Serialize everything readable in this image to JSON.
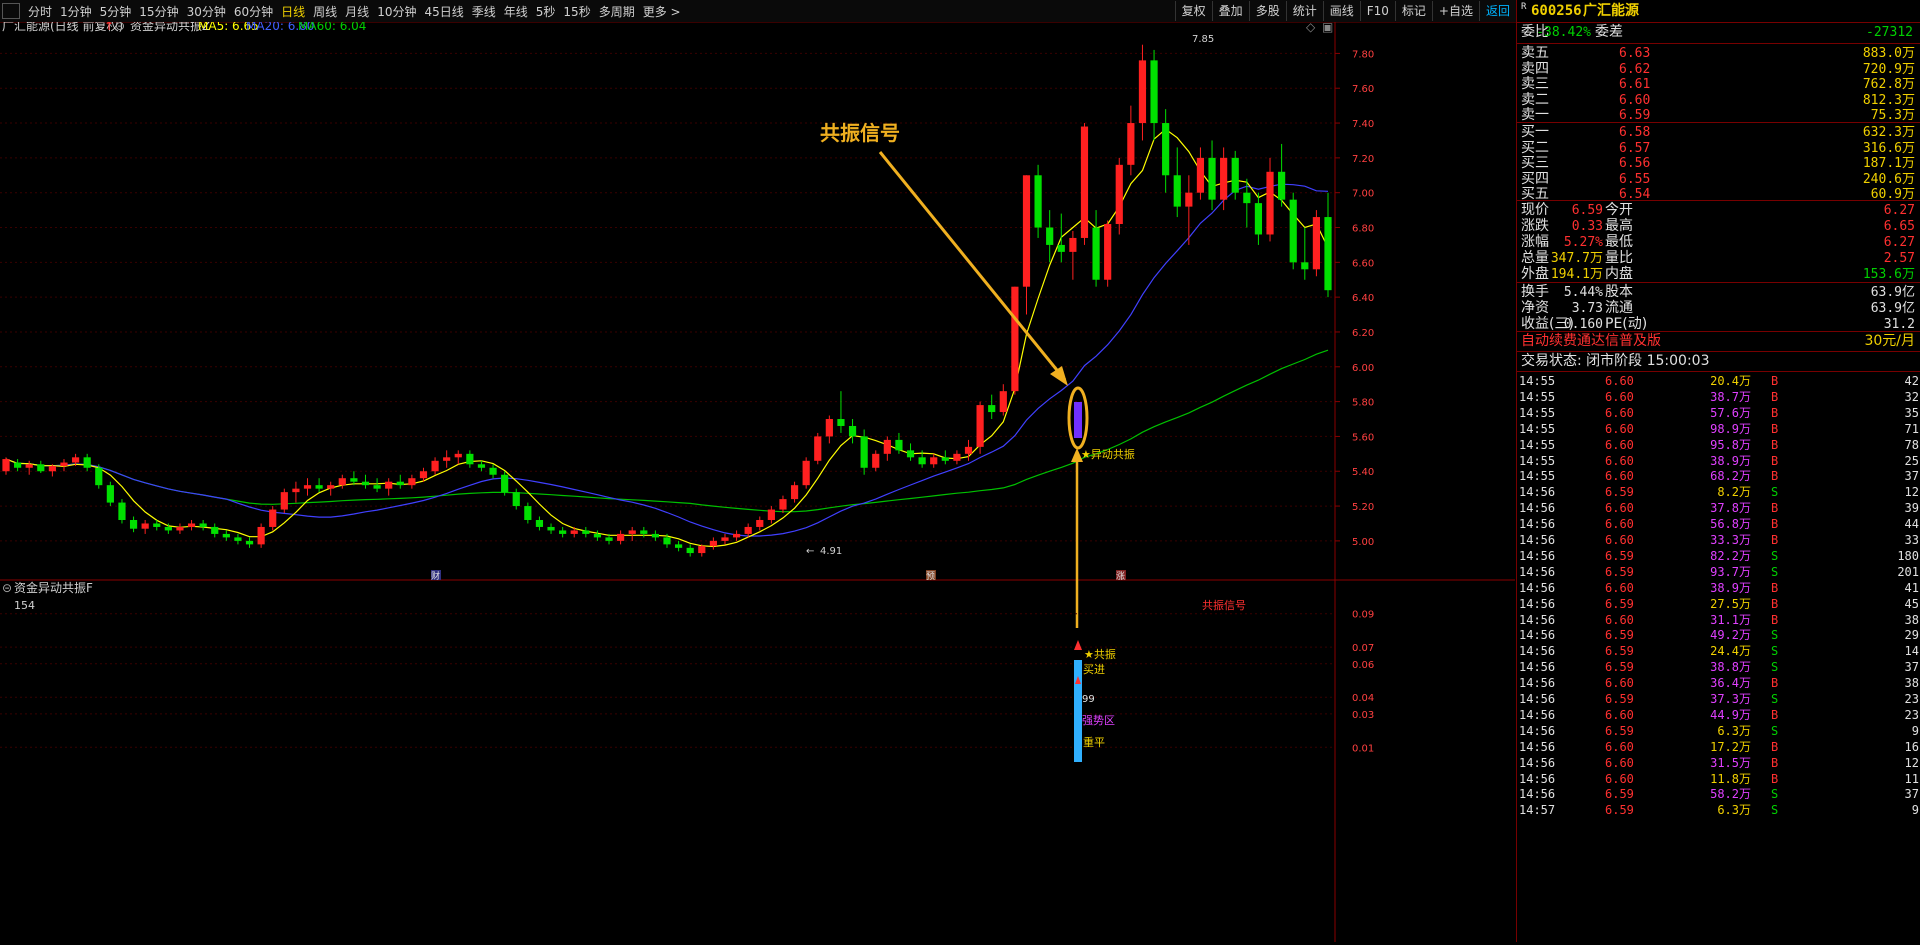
{
  "toolbar": {
    "timeframes": [
      "分时",
      "1分钟",
      "5分钟",
      "15分钟",
      "30分钟",
      "60分钟",
      "日线",
      "周线",
      "月线",
      "10分钟",
      "45日线",
      "季线",
      "年线",
      "5秒",
      "15秒",
      "多周期",
      "更多 >"
    ],
    "active": "日线",
    "tools": [
      "复权",
      "叠加",
      "多股",
      "统计",
      "画线",
      "F10",
      "标记",
      "+自选",
      "返回"
    ]
  },
  "main_header": {
    "stock": "广汇能源(日线 前复权)",
    "indicator": "资金异动共振Z",
    "ma5": "MA5: 6.65",
    "ma20": "MA20: 6.80",
    "ma60": "MA60: 6.04"
  },
  "sub_header": {
    "name": "资金异动共振F",
    "value": "154",
    "signal_label": "共振信号"
  },
  "annotations": {
    "callout": "共振信号",
    "star_label": "★异动共振",
    "high_label": "7.85",
    "low_label": "4.91",
    "markers": [
      "财",
      "预",
      "涨"
    ],
    "sub_labels": [
      "★共振",
      "买进",
      "99",
      "强势区",
      "重平"
    ]
  },
  "axes": {
    "main_y_ticks": [
      "7.80",
      "7.60",
      "7.40",
      "7.20",
      "7.00",
      "6.80",
      "6.60",
      "6.40",
      "6.20",
      "6.00",
      "5.80",
      "5.60",
      "5.40",
      "5.20",
      "5.00"
    ],
    "sub_y_ticks": [
      "0.09",
      "0.07",
      "0.06",
      "0.04",
      "0.03",
      "0.01"
    ]
  },
  "chart_data": {
    "type": "candlestick",
    "ohlc_note": "approximate daily candles read from chart",
    "candles": [
      [
        5.4,
        5.48,
        5.38,
        5.47
      ],
      [
        5.45,
        5.47,
        5.4,
        5.42
      ],
      [
        5.42,
        5.46,
        5.38,
        5.44
      ],
      [
        5.44,
        5.46,
        5.39,
        5.4
      ],
      [
        5.4,
        5.44,
        5.37,
        5.43
      ],
      [
        5.43,
        5.47,
        5.4,
        5.45
      ],
      [
        5.45,
        5.5,
        5.43,
        5.48
      ],
      [
        5.48,
        5.5,
        5.4,
        5.42
      ],
      [
        5.42,
        5.44,
        5.3,
        5.32
      ],
      [
        5.32,
        5.34,
        5.2,
        5.22
      ],
      [
        5.22,
        5.24,
        5.1,
        5.12
      ],
      [
        5.12,
        5.14,
        5.05,
        5.07
      ],
      [
        5.07,
        5.12,
        5.04,
        5.1
      ],
      [
        5.1,
        5.12,
        5.06,
        5.08
      ],
      [
        5.08,
        5.1,
        5.04,
        5.06
      ],
      [
        5.06,
        5.1,
        5.04,
        5.08
      ],
      [
        5.08,
        5.12,
        5.06,
        5.1
      ],
      [
        5.1,
        5.12,
        5.06,
        5.08
      ],
      [
        5.08,
        5.1,
        5.02,
        5.04
      ],
      [
        5.04,
        5.06,
        5.0,
        5.02
      ],
      [
        5.02,
        5.04,
        4.98,
        5.0
      ],
      [
        5.0,
        5.02,
        4.96,
        4.98
      ],
      [
        4.98,
        5.1,
        4.96,
        5.08
      ],
      [
        5.08,
        5.2,
        5.06,
        5.18
      ],
      [
        5.18,
        5.3,
        5.16,
        5.28
      ],
      [
        5.28,
        5.34,
        5.22,
        5.3
      ],
      [
        5.3,
        5.36,
        5.26,
        5.32
      ],
      [
        5.32,
        5.36,
        5.28,
        5.3
      ],
      [
        5.3,
        5.34,
        5.26,
        5.32
      ],
      [
        5.32,
        5.38,
        5.3,
        5.36
      ],
      [
        5.36,
        5.4,
        5.32,
        5.34
      ],
      [
        5.34,
        5.38,
        5.3,
        5.32
      ],
      [
        5.32,
        5.36,
        5.28,
        5.3
      ],
      [
        5.3,
        5.36,
        5.26,
        5.34
      ],
      [
        5.34,
        5.38,
        5.3,
        5.32
      ],
      [
        5.32,
        5.38,
        5.3,
        5.36
      ],
      [
        5.36,
        5.42,
        5.34,
        5.4
      ],
      [
        5.4,
        5.48,
        5.38,
        5.46
      ],
      [
        5.46,
        5.52,
        5.42,
        5.48
      ],
      [
        5.48,
        5.52,
        5.44,
        5.5
      ],
      [
        5.5,
        5.52,
        5.42,
        5.44
      ],
      [
        5.44,
        5.46,
        5.4,
        5.42
      ],
      [
        5.42,
        5.44,
        5.36,
        5.38
      ],
      [
        5.38,
        5.4,
        5.26,
        5.28
      ],
      [
        5.28,
        5.3,
        5.18,
        5.2
      ],
      [
        5.2,
        5.22,
        5.1,
        5.12
      ],
      [
        5.12,
        5.14,
        5.06,
        5.08
      ],
      [
        5.08,
        5.1,
        5.04,
        5.06
      ],
      [
        5.06,
        5.08,
        5.02,
        5.04
      ],
      [
        5.04,
        5.08,
        5.02,
        5.06
      ],
      [
        5.06,
        5.08,
        5.02,
        5.04
      ],
      [
        5.04,
        5.06,
        5.0,
        5.02
      ],
      [
        5.02,
        5.04,
        4.98,
        5.0
      ],
      [
        5.0,
        5.06,
        4.98,
        5.04
      ],
      [
        5.04,
        5.08,
        5.0,
        5.06
      ],
      [
        5.06,
        5.08,
        5.02,
        5.04
      ],
      [
        5.04,
        5.06,
        5.0,
        5.02
      ],
      [
        5.02,
        5.04,
        4.96,
        4.98
      ],
      [
        4.98,
        5.0,
        4.94,
        4.96
      ],
      [
        4.96,
        4.98,
        4.91,
        4.93
      ],
      [
        4.93,
        4.98,
        4.91,
        4.97
      ],
      [
        4.97,
        5.02,
        4.95,
        5.0
      ],
      [
        5.0,
        5.04,
        4.98,
        5.02
      ],
      [
        5.02,
        5.06,
        5.0,
        5.04
      ],
      [
        5.04,
        5.1,
        5.02,
        5.08
      ],
      [
        5.08,
        5.14,
        5.06,
        5.12
      ],
      [
        5.12,
        5.2,
        5.1,
        5.18
      ],
      [
        5.18,
        5.26,
        5.16,
        5.24
      ],
      [
        5.24,
        5.34,
        5.22,
        5.32
      ],
      [
        5.32,
        5.48,
        5.3,
        5.46
      ],
      [
        5.46,
        5.62,
        5.44,
        5.6
      ],
      [
        5.6,
        5.72,
        5.56,
        5.7
      ],
      [
        5.7,
        5.86,
        5.62,
        5.66
      ],
      [
        5.66,
        5.7,
        5.56,
        5.6
      ],
      [
        5.6,
        5.64,
        5.38,
        5.42
      ],
      [
        5.42,
        5.52,
        5.4,
        5.5
      ],
      [
        5.5,
        5.6,
        5.46,
        5.58
      ],
      [
        5.58,
        5.62,
        5.5,
        5.52
      ],
      [
        5.52,
        5.56,
        5.46,
        5.48
      ],
      [
        5.48,
        5.52,
        5.42,
        5.44
      ],
      [
        5.44,
        5.5,
        5.42,
        5.48
      ],
      [
        5.48,
        5.52,
        5.44,
        5.46
      ],
      [
        5.46,
        5.52,
        5.44,
        5.5
      ],
      [
        5.5,
        5.58,
        5.46,
        5.54
      ],
      [
        5.54,
        5.8,
        5.5,
        5.78
      ],
      [
        5.78,
        5.84,
        5.7,
        5.74
      ],
      [
        5.74,
        5.9,
        5.72,
        5.86
      ],
      [
        5.86,
        6.46,
        5.84,
        6.46
      ],
      [
        6.46,
        7.1,
        6.3,
        7.1
      ],
      [
        7.1,
        7.16,
        6.74,
        6.8
      ],
      [
        6.8,
        6.9,
        6.6,
        6.7
      ],
      [
        6.7,
        6.88,
        6.6,
        6.66
      ],
      [
        6.66,
        6.78,
        6.5,
        6.74
      ],
      [
        6.74,
        7.4,
        6.7,
        7.38
      ],
      [
        6.8,
        6.9,
        6.46,
        6.5
      ],
      [
        6.5,
        6.84,
        6.46,
        6.82
      ],
      [
        6.82,
        7.2,
        6.76,
        7.16
      ],
      [
        7.16,
        7.5,
        7.1,
        7.4
      ],
      [
        7.4,
        7.85,
        7.3,
        7.76
      ],
      [
        7.76,
        7.82,
        7.3,
        7.4
      ],
      [
        7.4,
        7.48,
        7.0,
        7.1
      ],
      [
        7.1,
        7.26,
        6.86,
        6.92
      ],
      [
        6.92,
        7.1,
        6.7,
        7.0
      ],
      [
        7.0,
        7.26,
        6.96,
        7.2
      ],
      [
        7.2,
        7.3,
        6.9,
        6.96
      ],
      [
        6.96,
        7.26,
        6.9,
        7.2
      ],
      [
        7.2,
        7.24,
        6.96,
        7.0
      ],
      [
        7.0,
        7.08,
        6.8,
        6.94
      ],
      [
        6.94,
        7.0,
        6.7,
        6.76
      ],
      [
        6.76,
        7.2,
        6.72,
        7.12
      ],
      [
        7.12,
        7.28,
        6.92,
        6.96
      ],
      [
        6.96,
        7.0,
        6.56,
        6.6
      ],
      [
        6.6,
        6.8,
        6.5,
        6.56
      ],
      [
        6.56,
        6.9,
        6.52,
        6.86
      ],
      [
        6.86,
        7.0,
        6.4,
        6.44
      ]
    ],
    "ma5_color": "#ffff00",
    "ma20_color": "#4040ff",
    "ma60_color": "#00c000",
    "up_color": "#ff2020",
    "down_color": "#00e000",
    "ylim": [
      4.85,
      7.9
    ]
  },
  "quote": {
    "code": "600256",
    "name": "广汇能源",
    "weibi_label": "委比",
    "weibi": "-38.42%",
    "weicha_label": "委差",
    "weicha": "-27312",
    "asks": [
      {
        "label": "卖五",
        "price": "6.63",
        "vol": "883.0万"
      },
      {
        "label": "卖四",
        "price": "6.62",
        "vol": "720.9万"
      },
      {
        "label": "卖三",
        "price": "6.61",
        "vol": "762.8万"
      },
      {
        "label": "卖二",
        "price": "6.60",
        "vol": "812.3万"
      },
      {
        "label": "卖一",
        "price": "6.59",
        "vol": "75.3万"
      }
    ],
    "bids": [
      {
        "label": "买一",
        "price": "6.58",
        "vol": "632.3万"
      },
      {
        "label": "买二",
        "price": "6.57",
        "vol": "316.6万"
      },
      {
        "label": "买三",
        "price": "6.56",
        "vol": "187.1万"
      },
      {
        "label": "买四",
        "price": "6.55",
        "vol": "240.6万"
      },
      {
        "label": "买五",
        "price": "6.54",
        "vol": "60.9万"
      }
    ],
    "stats": [
      [
        "现价",
        "6.59",
        "今开",
        "6.27"
      ],
      [
        "涨跌",
        "0.33",
        "最高",
        "6.65"
      ],
      [
        "涨幅",
        "5.27%",
        "最低",
        "6.27"
      ],
      [
        "总量",
        "347.7万",
        "量比",
        "2.57"
      ],
      [
        "外盘",
        "194.1万",
        "内盘",
        "153.6万"
      ]
    ],
    "stats2": [
      [
        "换手",
        "5.44%",
        "股本",
        "63.9亿"
      ],
      [
        "净资",
        "3.73",
        "流通",
        "63.9亿"
      ],
      [
        "收益(三)",
        "0.160",
        "PE(动)",
        "31.2"
      ]
    ],
    "ad": "自动续费通达信普及版",
    "ad_price": "30元/月",
    "status": "交易状态: 闭市阶段 15:00:03"
  },
  "ticks": [
    [
      "14:55",
      "6.60",
      "20.4万",
      "B",
      "42"
    ],
    [
      "14:55",
      "6.60",
      "38.7万",
      "B",
      "32"
    ],
    [
      "14:55",
      "6.60",
      "57.6万",
      "B",
      "35"
    ],
    [
      "14:55",
      "6.60",
      "98.9万",
      "B",
      "71"
    ],
    [
      "14:55",
      "6.60",
      "95.8万",
      "B",
      "78"
    ],
    [
      "14:55",
      "6.60",
      "38.9万",
      "B",
      "25"
    ],
    [
      "14:55",
      "6.60",
      "68.2万",
      "B",
      "37"
    ],
    [
      "14:56",
      "6.59",
      "8.2万",
      "S",
      "12"
    ],
    [
      "14:56",
      "6.60",
      "37.8万",
      "B",
      "39"
    ],
    [
      "14:56",
      "6.60",
      "56.8万",
      "B",
      "44"
    ],
    [
      "14:56",
      "6.60",
      "33.3万",
      "B",
      "33"
    ],
    [
      "14:56",
      "6.59",
      "82.2万",
      "S",
      "180"
    ],
    [
      "14:56",
      "6.59",
      "93.7万",
      "S",
      "201"
    ],
    [
      "14:56",
      "6.60",
      "38.9万",
      "B",
      "41"
    ],
    [
      "14:56",
      "6.59",
      "27.5万",
      "B",
      "45"
    ],
    [
      "14:56",
      "6.60",
      "31.1万",
      "B",
      "38"
    ],
    [
      "14:56",
      "6.59",
      "49.2万",
      "S",
      "29"
    ],
    [
      "14:56",
      "6.59",
      "24.4万",
      "S",
      "14"
    ],
    [
      "14:56",
      "6.59",
      "38.8万",
      "S",
      "37"
    ],
    [
      "14:56",
      "6.60",
      "36.4万",
      "B",
      "38"
    ],
    [
      "14:56",
      "6.59",
      "37.3万",
      "S",
      "23"
    ],
    [
      "14:56",
      "6.60",
      "44.9万",
      "B",
      "23"
    ],
    [
      "14:56",
      "6.59",
      "6.3万",
      "S",
      "9"
    ],
    [
      "14:56",
      "6.60",
      "17.2万",
      "B",
      "16"
    ],
    [
      "14:56",
      "6.60",
      "31.5万",
      "B",
      "12"
    ],
    [
      "14:56",
      "6.60",
      "11.8万",
      "B",
      "11"
    ],
    [
      "14:56",
      "6.59",
      "58.2万",
      "S",
      "37"
    ],
    [
      "14:57",
      "6.59",
      "6.3万",
      "S",
      "9"
    ]
  ]
}
